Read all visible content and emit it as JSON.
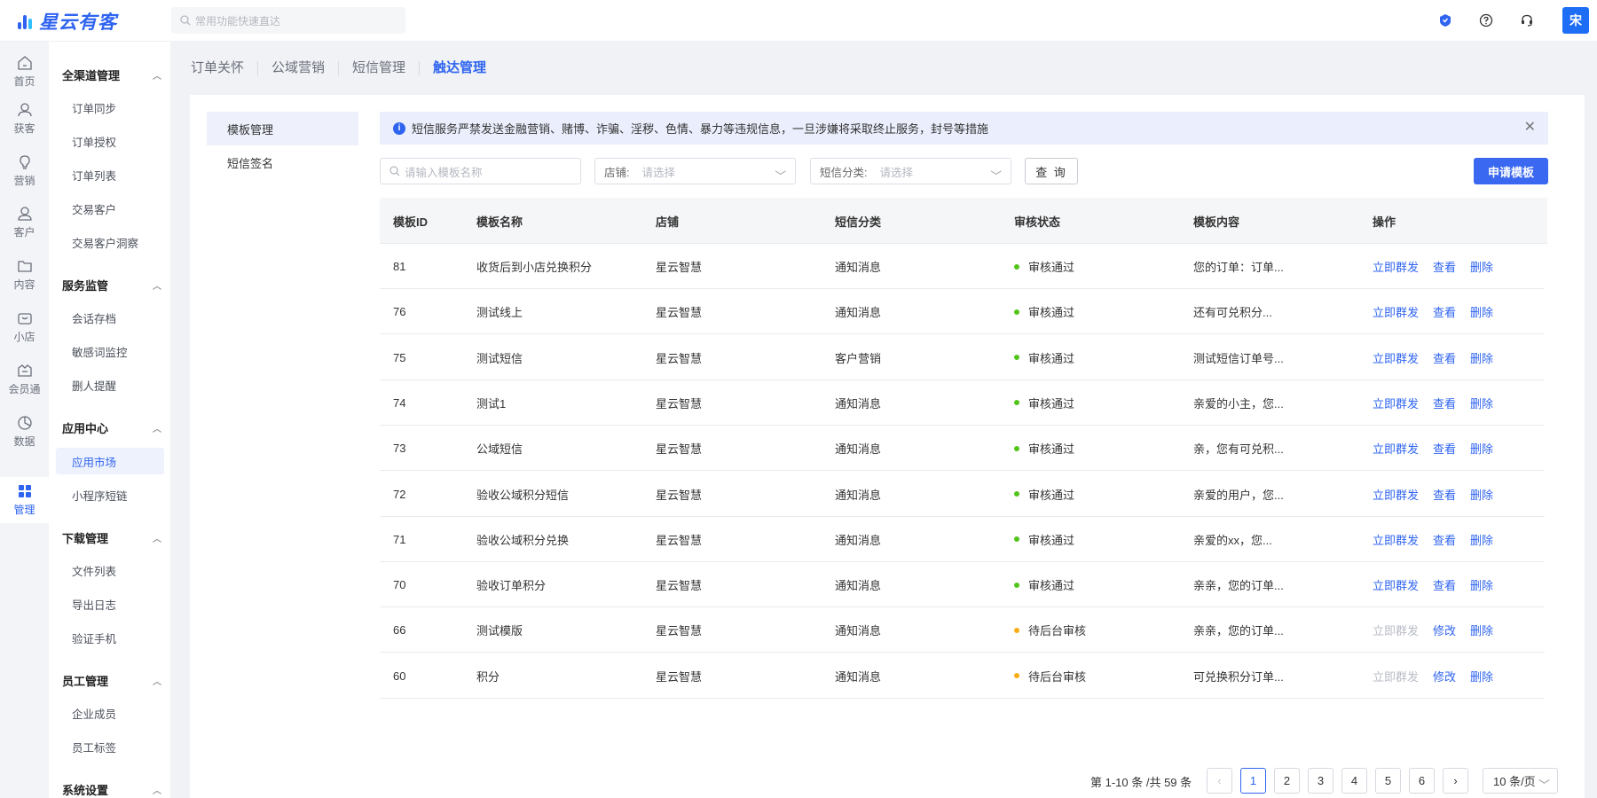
{
  "app": {
    "name": "星云有客"
  },
  "search": {
    "placeholder": "常用功能快速直达"
  },
  "user": {
    "avatar_text": "宋"
  },
  "rail": [
    {
      "label": "首页",
      "icon": "home-icon"
    },
    {
      "label": "获客",
      "icon": "acquire-user-icon"
    },
    {
      "label": "营销",
      "icon": "lightbulb-icon"
    },
    {
      "label": "客户",
      "icon": "user-icon"
    },
    {
      "label": "内容",
      "icon": "folder-icon"
    },
    {
      "label": "小店",
      "icon": "shop-icon"
    },
    {
      "label": "会员通",
      "icon": "member-icon"
    },
    {
      "label": "数据",
      "icon": "pie-chart-icon"
    },
    {
      "label": "管理",
      "icon": "grid-apps-icon"
    }
  ],
  "subnav": {
    "groups": [
      {
        "title": "全渠道管理",
        "items": [
          "订单同步",
          "订单授权",
          "订单列表",
          "交易客户",
          "交易客户洞察"
        ]
      },
      {
        "title": "服务监管",
        "items": [
          "会话存档",
          "敏感词监控",
          "删人提醒"
        ]
      },
      {
        "title": "应用中心",
        "items": [
          "应用市场",
          "小程序短链"
        ]
      },
      {
        "title": "下载管理",
        "items": [
          "文件列表",
          "导出日志",
          "验证手机"
        ]
      },
      {
        "title": "员工管理",
        "items": [
          "企业成员",
          "员工标签"
        ]
      },
      {
        "title": "系统设置",
        "items": []
      }
    ],
    "active_item": "应用市场"
  },
  "breadcrumbs": [
    "订单关怀",
    "公域营销",
    "短信管理",
    "触达管理"
  ],
  "left_menu": [
    "模板管理",
    "短信签名"
  ],
  "notice": {
    "text": "短信服务严禁发送金融营销、赌博、诈骗、淫秽、色情、暴力等违规信息，一旦涉嫌将采取终止服务，封号等措施"
  },
  "filters": {
    "name_placeholder": "请输入模板名称",
    "shop_label": "店铺:",
    "shop_placeholder": "请选择",
    "category_label": "短信分类:",
    "category_placeholder": "请选择",
    "query_label": "查 询",
    "apply_label": "申请模板"
  },
  "table": {
    "headers": [
      "模板ID",
      "模板名称",
      "店铺",
      "短信分类",
      "审核状态",
      "模板内容",
      "操作"
    ],
    "rows": [
      {
        "id": "81",
        "name": "收货后到小店兑换积分",
        "shop": "星云智慧",
        "category": "通知消息",
        "status": "审核通过",
        "status_color": "#52c41a",
        "content": "您的订单：订单...",
        "actions": [
          "立即群发",
          "查看",
          "删除"
        ],
        "send_disabled": false
      },
      {
        "id": "76",
        "name": "测试线上",
        "shop": "星云智慧",
        "category": "通知消息",
        "status": "审核通过",
        "status_color": "#52c41a",
        "content": "还有可兑积分...",
        "actions": [
          "立即群发",
          "查看",
          "删除"
        ],
        "send_disabled": false
      },
      {
        "id": "75",
        "name": "测试短信",
        "shop": "星云智慧",
        "category": "客户营销",
        "status": "审核通过",
        "status_color": "#52c41a",
        "content": "测试短信订单号...",
        "actions": [
          "立即群发",
          "查看",
          "删除"
        ],
        "send_disabled": false
      },
      {
        "id": "74",
        "name": "测试1",
        "shop": "星云智慧",
        "category": "通知消息",
        "status": "审核通过",
        "status_color": "#52c41a",
        "content": "亲爱的小主，您...",
        "actions": [
          "立即群发",
          "查看",
          "删除"
        ],
        "send_disabled": false
      },
      {
        "id": "73",
        "name": "公域短信",
        "shop": "星云智慧",
        "category": "通知消息",
        "status": "审核通过",
        "status_color": "#52c41a",
        "content": "亲，您有可兑积...",
        "actions": [
          "立即群发",
          "查看",
          "删除"
        ],
        "send_disabled": false
      },
      {
        "id": "72",
        "name": "验收公域积分短信",
        "shop": "星云智慧",
        "category": "通知消息",
        "status": "审核通过",
        "status_color": "#52c41a",
        "content": "亲爱的用户，您...",
        "actions": [
          "立即群发",
          "查看",
          "删除"
        ],
        "send_disabled": false
      },
      {
        "id": "71",
        "name": "验收公域积分兑换",
        "shop": "星云智慧",
        "category": "通知消息",
        "status": "审核通过",
        "status_color": "#52c41a",
        "content": "亲爱的xx，您...",
        "actions": [
          "立即群发",
          "查看",
          "删除"
        ],
        "send_disabled": false
      },
      {
        "id": "70",
        "name": "验收订单积分",
        "shop": "星云智慧",
        "category": "通知消息",
        "status": "审核通过",
        "status_color": "#52c41a",
        "content": "亲亲，您的订单...",
        "actions": [
          "立即群发",
          "查看",
          "删除"
        ],
        "send_disabled": false
      },
      {
        "id": "66",
        "name": "测试模版",
        "shop": "星云智慧",
        "category": "通知消息",
        "status": "待后台审核",
        "status_color": "#faad14",
        "content": "亲亲，您的订单...",
        "actions": [
          "立即群发",
          "修改",
          "删除"
        ],
        "send_disabled": true
      },
      {
        "id": "60",
        "name": "积分",
        "shop": "星云智慧",
        "category": "通知消息",
        "status": "待后台审核",
        "status_color": "#faad14",
        "content": "可兑换积分订单...",
        "actions": [
          "立即群发",
          "修改",
          "删除"
        ],
        "send_disabled": true
      }
    ]
  },
  "pagination": {
    "summary": "第 1-10 条 /共 59 条",
    "pages": [
      "1",
      "2",
      "3",
      "4",
      "5",
      "6"
    ],
    "current": "1",
    "page_size": "10 条/页"
  },
  "colors": {
    "accent": "#2f64f0",
    "approved": "#52c41a",
    "pending": "#faad14"
  }
}
